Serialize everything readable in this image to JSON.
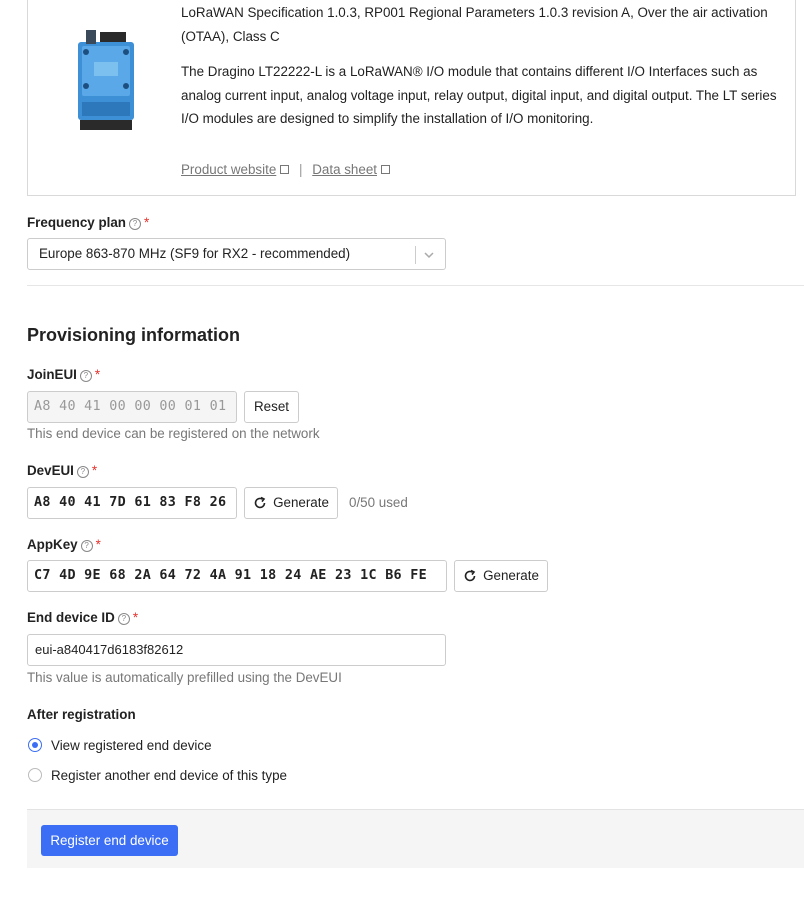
{
  "device": {
    "spec_text": "LoRaWAN Specification 1.0.3, RP001 Regional Parameters 1.0.3 revision A, Over the air activation (OTAA), Class C",
    "description": "The Dragino LT22222-L is a LoRaWAN® I/O module that contains different I/O Interfaces such as analog current input, analog voltage input, relay output, digital input, and digital output. The LT series I/O modules are designed to simplify the installation of I/O monitoring.",
    "product_website_label": "Product website",
    "separator": "|",
    "data_sheet_label": "Data sheet"
  },
  "frequency_plan": {
    "label": "Frequency plan",
    "required_mark": "*",
    "selected": "Europe 863-870 MHz (SF9 for RX2 - recommended)"
  },
  "provisioning": {
    "title": "Provisioning information",
    "join_eui": {
      "label": "JoinEUI",
      "required_mark": "*",
      "value": "A8 40 41 00 00 00 01 01",
      "reset_label": "Reset",
      "hint": "This end device can be registered on the network"
    },
    "dev_eui": {
      "label": "DevEUI",
      "required_mark": "*",
      "value": "A8 40 41 7D 61 83 F8 26",
      "generate_label": "Generate",
      "usage": "0/50 used"
    },
    "app_key": {
      "label": "AppKey",
      "required_mark": "*",
      "value": "C7 4D 9E 68 2A 64 72 4A 91 18 24 AE 23 1C B6 FE",
      "generate_label": "Generate"
    },
    "end_device_id": {
      "label": "End device ID",
      "required_mark": "*",
      "value": "eui-a840417d6183f82612",
      "hint": "This value is automatically prefilled using the DevEUI"
    }
  },
  "after_registration": {
    "label": "After registration",
    "options": [
      {
        "label": "View registered end device",
        "checked": true
      },
      {
        "label": "Register another end device of this type",
        "checked": false
      }
    ]
  },
  "footer": {
    "submit_label": "Register end device"
  },
  "colors": {
    "primary": "#3b6ef5",
    "required": "#e5322d"
  }
}
